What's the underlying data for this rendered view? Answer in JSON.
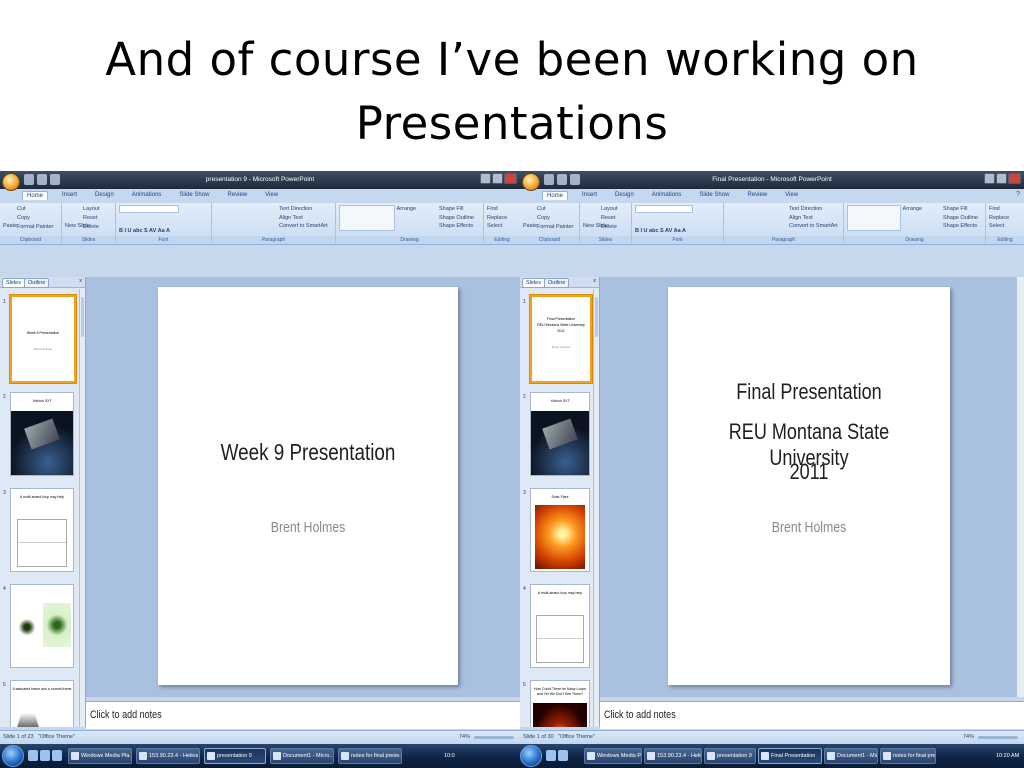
{
  "slide_title": "And of course I’ve been working on Presentations",
  "left_window": {
    "title": "presentation 9 - Microsoft PowerPoint",
    "tabs": [
      "Home",
      "Insert",
      "Design",
      "Animations",
      "Slide Show",
      "Review",
      "View"
    ],
    "ribbon": {
      "clipboard": {
        "label": "Clipboard",
        "items": [
          "Cut",
          "Copy",
          "Paste",
          "Format Painter"
        ]
      },
      "slides": {
        "label": "Slides",
        "items": [
          "New Slide",
          "Layout",
          "Reset",
          "Delete"
        ]
      },
      "font": {
        "label": "Font"
      },
      "paragraph": {
        "label": "Paragraph",
        "items": [
          "Text Direction",
          "Align Text",
          "Convert to SmartArt"
        ]
      },
      "drawing": {
        "label": "Drawing",
        "items": [
          "Arrange",
          "Quick Styles",
          "Shape Fill",
          "Shape Outline",
          "Shape Effects"
        ]
      },
      "editing": {
        "label": "Editing",
        "items": [
          "Find",
          "Replace",
          "Select"
        ]
      }
    },
    "panel_tabs": {
      "slides": "Slides",
      "outline": "Outline",
      "close": "x"
    },
    "thumbnails": [
      {
        "num": "1",
        "title": "Week 9 Presentation",
        "sub": "Brent Holmes"
      },
      {
        "num": "2",
        "title": "Yohkoh SXT"
      },
      {
        "num": "3",
        "title": "A multi-strand loop may help"
      },
      {
        "num": "4",
        "title": ""
      },
      {
        "num": "5",
        "title": "A saturated frame and a normal frame"
      }
    ],
    "main_slide": {
      "title": "Week 9 Presentation",
      "subtitle": "Brent Holmes"
    },
    "notes_placeholder": "Click to add notes",
    "status": {
      "slide": "Slide 1 of 23",
      "theme": "\"Office Theme\"",
      "zoom": "74%"
    }
  },
  "right_window": {
    "title": "Final Presentation - Microsoft PowerPoint",
    "tabs": [
      "Home",
      "Insert",
      "Design",
      "Animations",
      "Slide Show",
      "Review",
      "View"
    ],
    "ribbon": {
      "clipboard": {
        "label": "Clipboard",
        "items": [
          "Cut",
          "Copy",
          "Paste",
          "Format Painter"
        ]
      },
      "slides": {
        "label": "Slides",
        "items": [
          "New Slide",
          "Layout",
          "Reset",
          "Delete"
        ]
      },
      "font": {
        "label": "Font"
      },
      "paragraph": {
        "label": "Paragraph",
        "items": [
          "Text Direction",
          "Align Text",
          "Convert to SmartArt"
        ]
      },
      "drawing": {
        "label": "Drawing",
        "items": [
          "Arrange",
          "Quick Styles",
          "Shape Fill",
          "Shape Outline",
          "Shape Effects"
        ]
      },
      "editing": {
        "label": "Editing",
        "items": [
          "Find",
          "Replace",
          "Select"
        ]
      }
    },
    "panel_tabs": {
      "slides": "Slides",
      "outline": "Outline",
      "close": "x"
    },
    "thumbnails": [
      {
        "num": "1",
        "title": "Final Presentation",
        "sub1": "REU Montana State University",
        "sub2": "2011",
        "sub": "Brent Holmes"
      },
      {
        "num": "2",
        "title": "Yohkoh SXT"
      },
      {
        "num": "3",
        "title": "Solar Flare"
      },
      {
        "num": "4",
        "title": "A multi-strand loop may help"
      },
      {
        "num": "5",
        "title": "How Could There be Many Loops and Yet We Don't See Them?"
      }
    ],
    "main_slide": {
      "title_line1": "Final Presentation",
      "title_line2": "REU Montana State University",
      "title_line3": "2011",
      "subtitle": "Brent Holmes"
    },
    "notes_placeholder": "Click to add notes",
    "status": {
      "slide": "Slide 1 of 30",
      "theme": "\"Office Theme\"",
      "zoom": "74%"
    }
  },
  "taskbar": {
    "left_items": [
      "Windows Media Pla...",
      "153.90.23.4 - Helios ...",
      "presentation 9"
    ],
    "left_items_2": [
      "Document1 - Micro...",
      "notes for final prese..."
    ],
    "right_items": [
      "Windows Media P...",
      "153.90.23.4 - Helio...",
      "presentation 9",
      "Final Presentation",
      "Document1 - Micr...",
      "notes for final pre..."
    ],
    "clock_left": "10:0",
    "clock_right": "10:20 AM"
  },
  "colors": {
    "titlebar": "#1e2a3a",
    "ribbon": "#c9dbf2",
    "stage": "#a9c0e0",
    "taskbar": "#0f2345",
    "selection": "#f2a21b"
  },
  "icons": [
    "office-button-icon",
    "save-icon",
    "undo-icon",
    "redo-icon",
    "cut-icon",
    "copy-icon",
    "paste-icon",
    "find-icon",
    "start-orb-icon"
  ]
}
